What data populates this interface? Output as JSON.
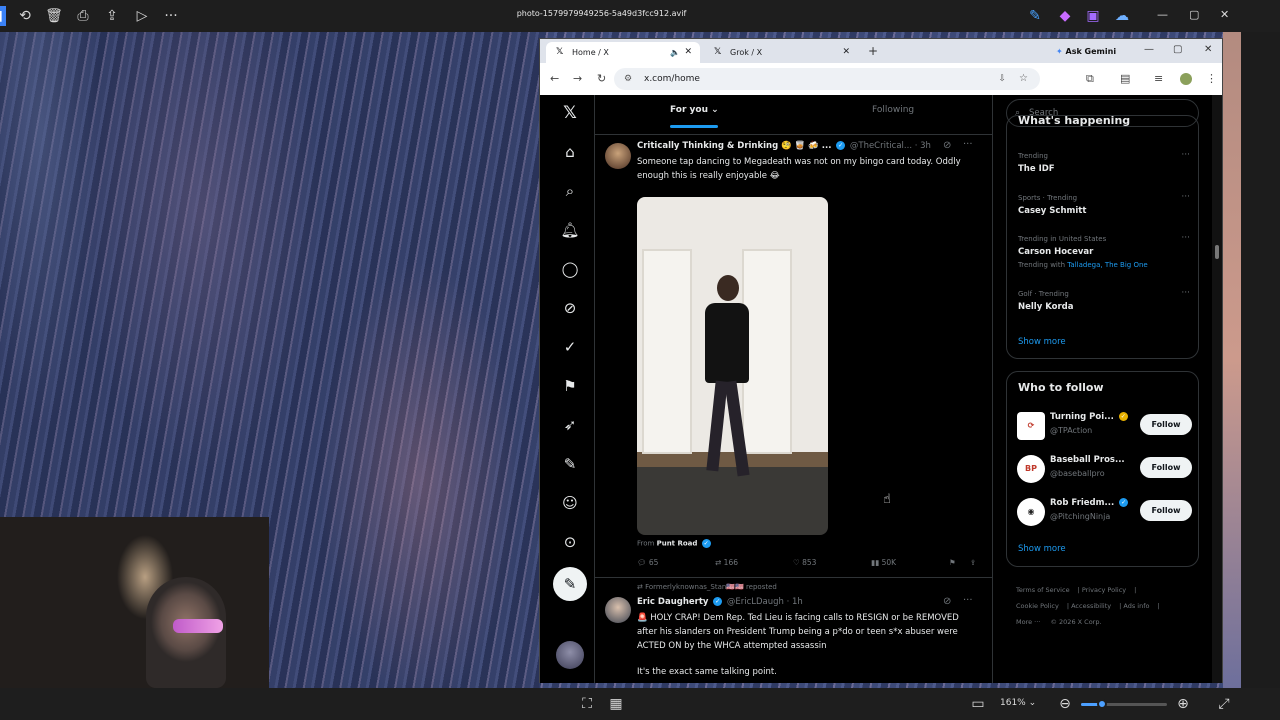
{
  "viewer": {
    "title": "photo-1579979949256-5a49d3fcc912.avif",
    "zoom": "161%",
    "zoom_fraction": 0.24
  },
  "browser": {
    "tabs": [
      {
        "label": "Home / X"
      },
      {
        "label": "Grok / X"
      }
    ],
    "ask_gemini": "Ask Gemini",
    "url": "x.com/home"
  },
  "timeline": {
    "tab_for_you": "For you",
    "tab_following": "Following",
    "tweet1": {
      "name": "Critically Thinking & Drinking 🧐 🥃 🍻 ...",
      "handle": "@TheCritical...",
      "time": "· 3h",
      "text": "Someone tap dancing to Megadeath was not on my bingo card today. Oddly enough this is really enjoyable 😂",
      "from_prefix": "From",
      "from_source": "Punt Road",
      "replies": "65",
      "reposts": "166",
      "likes": "853",
      "views": "50K"
    },
    "tweet2": {
      "reposted_by": "Formerlyknownas_Stan🇺🇸🇺🇸 reposted",
      "name": "Eric Daugherty",
      "handle": "@EricLDaugh",
      "time": "· 1h",
      "text": "🚨 HOLY CRAP! Dem Rep. Ted Lieu is facing calls to RESIGN or be REMOVED after his slanders on President Trump being a p*do or teen s*x abuser were ACTED ON by the WHCA attempted assassin",
      "text2": "It's the exact same talking point."
    }
  },
  "sidebar": {
    "search_placeholder": "Search",
    "trends_title": "What's happening",
    "trends": [
      {
        "meta": "Trending",
        "name": "The IDF"
      },
      {
        "meta": "Sports · Trending",
        "name": "Casey Schmitt"
      },
      {
        "meta": "Trending in United States",
        "name": "Carson Hocevar",
        "with_prefix": "Trending with",
        "with_links": "Talladega, The Big One"
      },
      {
        "meta": "Golf · Trending",
        "name": "Nelly Korda"
      }
    ],
    "show_more": "Show more",
    "wtf_title": "Who to follow",
    "follow": [
      {
        "name": "Turning Poi...",
        "handle": "@TPAction",
        "button": "Follow"
      },
      {
        "name": "Baseball Pros...",
        "handle": "@baseballpro",
        "button": "Follow"
      },
      {
        "name": "Rob Friedm...",
        "handle": "@PitchingNinja",
        "button": "Follow"
      }
    ],
    "show_more2": "Show more",
    "footer": {
      "terms": "Terms of Service",
      "privacy": "Privacy Policy",
      "cookie": "Cookie Policy",
      "accessibility": "Accessibility",
      "ads": "Ads info",
      "more": "More ···",
      "copyright": "© 2026 X Corp."
    }
  }
}
